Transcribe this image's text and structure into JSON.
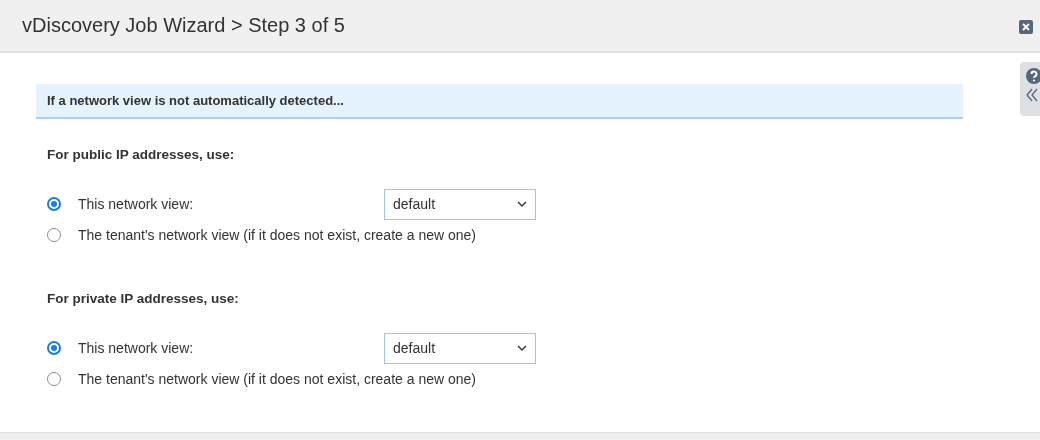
{
  "window": {
    "title": "vDiscovery Job Wizard > Step 3 of 5"
  },
  "banner": "If a network view is not automatically detected...",
  "sections": [
    {
      "heading": "For public IP addresses, use:",
      "options": [
        {
          "label": "This network view:",
          "selected": true,
          "dropdown": {
            "value": "default"
          }
        },
        {
          "label": "The tenant's network view (if it does not exist, create a new one)",
          "selected": false
        }
      ]
    },
    {
      "heading": "For private IP addresses, use:",
      "options": [
        {
          "label": "This network view:",
          "selected": true,
          "dropdown": {
            "value": "default"
          }
        },
        {
          "label": "The tenant's network view (if it does not exist, create a new one)",
          "selected": false
        }
      ]
    }
  ]
}
